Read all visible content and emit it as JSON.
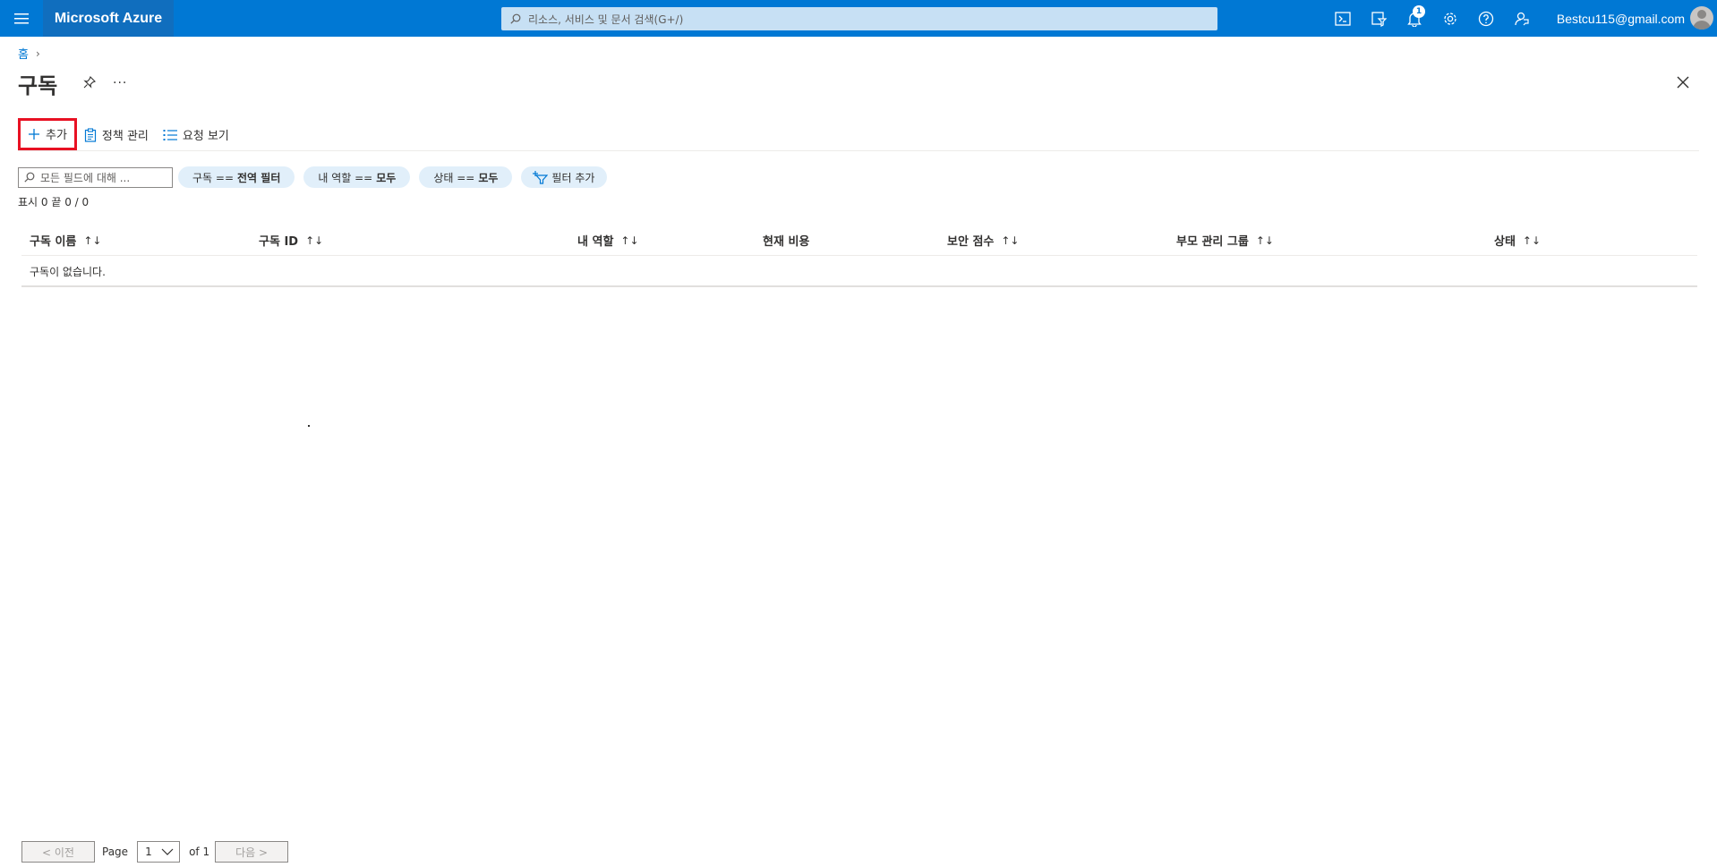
{
  "topbar": {
    "brand": "Microsoft Azure",
    "search_placeholder": "리소스, 서비스 및 문서 검색(G+/)",
    "notification_count": "1",
    "account": "Bestcu115@gmail.com",
    "icons": [
      "cloud-shell-icon",
      "directory-filter-icon",
      "notifications-icon",
      "settings-icon",
      "help-icon",
      "feedback-icon"
    ],
    "color": "#0078d4"
  },
  "breadcrumb": {
    "home": "홈"
  },
  "page": {
    "title": "구독",
    "more": "···"
  },
  "commands": {
    "add": "추가",
    "manage_policies": "정책 관리",
    "view_requests": "요청 보기"
  },
  "filters": {
    "search_placeholder": "모든 필드에 대해 ...",
    "pills": [
      {
        "key": "구독 ==",
        "value": "전역 필터"
      },
      {
        "key": "내 역할 ==",
        "value": "모두"
      },
      {
        "key": "상태 ==",
        "value": "모두"
      }
    ],
    "add_filter": "필터 추가"
  },
  "count_text": "표시 0 끝 0 / 0",
  "table": {
    "columns": [
      "구독 이름",
      "구독 ID",
      "내 역할",
      "현재 비용",
      "보안 점수",
      "부모 관리 그룹",
      "상태"
    ],
    "sort_glyph": "↑↓",
    "empty_message": "구독이 없습니다."
  },
  "pager": {
    "prev": "< 이전",
    "page_label": "Page",
    "page_value": "1",
    "of_label": "of 1",
    "next": "다음 >"
  }
}
